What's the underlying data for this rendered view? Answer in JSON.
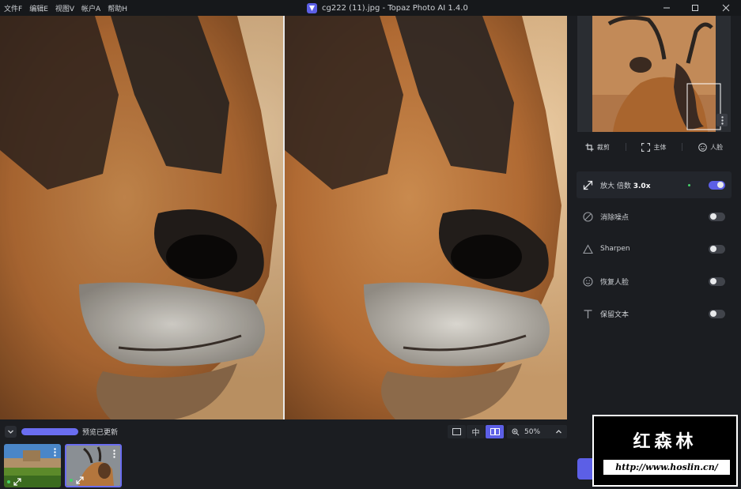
{
  "menu": [
    "文件F",
    "编辑E",
    "视图V",
    "帐户A",
    "帮助H"
  ],
  "window_title": "cg222 (11).jpg - Topaz Photo AI 1.4.0",
  "status": {
    "text": "预览已更新",
    "progress": 1.0
  },
  "view_modes": [
    "single-view",
    "split-view",
    "side-by-side-view"
  ],
  "view_mode_active": "side-by-side-view",
  "view_split_label": "中",
  "zoom": {
    "value": "50%"
  },
  "crop_bar": {
    "crop": "裁剪",
    "subject": "主体",
    "face": "人脸"
  },
  "tools": [
    {
      "id": "upscale",
      "label_prefix": "放大 倍数",
      "value": "3.0x",
      "enabled": true
    },
    {
      "id": "denoise",
      "label": "消除噪点",
      "enabled": false
    },
    {
      "id": "sharpen",
      "label": "Sharpen",
      "enabled": false
    },
    {
      "id": "face",
      "label": "恢复人脸",
      "enabled": false
    },
    {
      "id": "text",
      "label": "保留文本",
      "enabled": false
    }
  ],
  "watermark": {
    "title": "红森林",
    "url": "http://www.hoslin.cn/"
  },
  "colors": {
    "accent": "#5c5fe6",
    "status_ok": "#46d16a",
    "bg": "#1b1d21"
  }
}
